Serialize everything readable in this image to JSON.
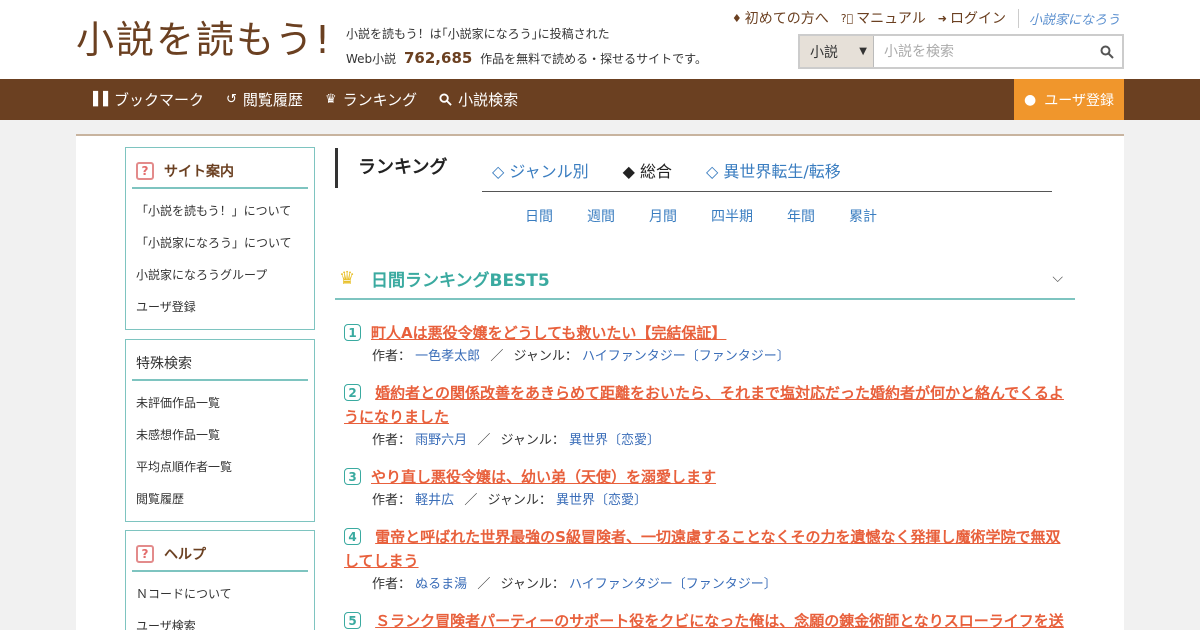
{
  "header": {
    "logo_text": "小説を読もう!",
    "tagline_line1": "小説を読もう！は｢小説家になろう｣に投稿された",
    "tagline_prefix": "Web小説",
    "tagline_count": "762,685",
    "tagline_suffix": "作品を無料で読める・探せるサイトです。",
    "top_links": {
      "first_time": "初めての方へ",
      "manual": "マニュアル",
      "login": "ログイン",
      "narou_logo": "小説家になろう"
    },
    "search": {
      "type_value": "小説",
      "placeholder": "小説を検索"
    }
  },
  "nav": {
    "bookmark": "ブックマーク",
    "history": "閲覧履歴",
    "ranking": "ランキング",
    "search": "小説検索",
    "register": "ユーザ登録"
  },
  "sidebar": {
    "site_guide": {
      "title": "サイト案内",
      "items": [
        "「小説を読もう！」について",
        "「小説家になろう」について",
        "小説家になろうグループ",
        "ユーザ登録"
      ]
    },
    "special_search": {
      "title": "特殊検索",
      "items": [
        "未評価作品一覧",
        "未感想作品一覧",
        "平均点順作者一覧",
        "閲覧履歴"
      ]
    },
    "help": {
      "title": "ヘルプ",
      "items": [
        "Ｎコードについて",
        "ユーザ検索"
      ]
    }
  },
  "ranking": {
    "title": "ランキング",
    "tabs": [
      "◇ ジャンル別",
      "◆ 総合",
      "◇ 異世界転生/転移"
    ],
    "periods": [
      "日間",
      "週間",
      "月間",
      "四半期",
      "年間",
      "累計"
    ],
    "best_title": "日間ランキングBEST5",
    "author_label": "作者：",
    "genre_label": "ジャンル：",
    "items": [
      {
        "no": "1",
        "title": "町人Aは悪役令嬢をどうしても救いたい【完結保証】",
        "author": "一色孝太郎",
        "genre": "ハイファンタジー〔ファンタジー〕"
      },
      {
        "no": "2",
        "title": "婚約者との関係改善をあきらめて距離をおいたら、それまで塩対応だった婚約者が何かと絡んでくるようになりました",
        "author": "雨野六月",
        "genre": "異世界〔恋愛〕"
      },
      {
        "no": "3",
        "title": "やり直し悪役令嬢は、幼い弟（天使）を溺愛します",
        "author": "軽井広",
        "genre": "異世界〔恋愛〕"
      },
      {
        "no": "4",
        "title": "雷帝と呼ばれた世界最強のS級冒険者、一切遠慮することなくその力を遺憾なく発揮し魔術学院で無双してしまう",
        "author": "ぬるま湯",
        "genre": "ハイファンタジー〔ファンタジー〕"
      },
      {
        "no": "5",
        "title": "Ｓランク冒険者パーティーのサポート役をクビになった俺は、念願の錬金術師となりスローライフを送"
      }
    ]
  }
}
